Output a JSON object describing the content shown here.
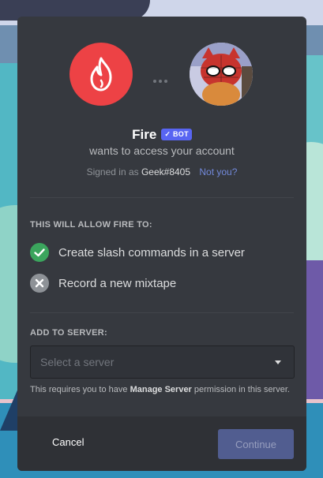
{
  "app": {
    "bot_name": "Fire",
    "bot_badge": "BOT",
    "subtitle": "wants to access your account",
    "signed_in_prefix": "Signed in as",
    "username": "Geek#8405",
    "not_you_link": "Not you?",
    "accent_color": "#5865f2",
    "bot_avatar_color": "#ed4245"
  },
  "permissions": {
    "title": "THIS WILL ALLOW FIRE TO:",
    "items": [
      {
        "label": "Create slash commands in a server",
        "status": "allowed",
        "icon": "check-circle-icon",
        "color": "#3ba55d"
      },
      {
        "label": "Record a new mixtape",
        "status": "denied",
        "icon": "x-circle-icon",
        "color": "#8e9297"
      }
    ]
  },
  "server": {
    "title": "ADD TO SERVER:",
    "placeholder": "Select a server",
    "note_prefix": "This requires you to have",
    "note_bold": "Manage Server",
    "note_suffix": "permission in this server."
  },
  "footer": {
    "cancel_label": "Cancel",
    "continue_label": "Continue"
  }
}
